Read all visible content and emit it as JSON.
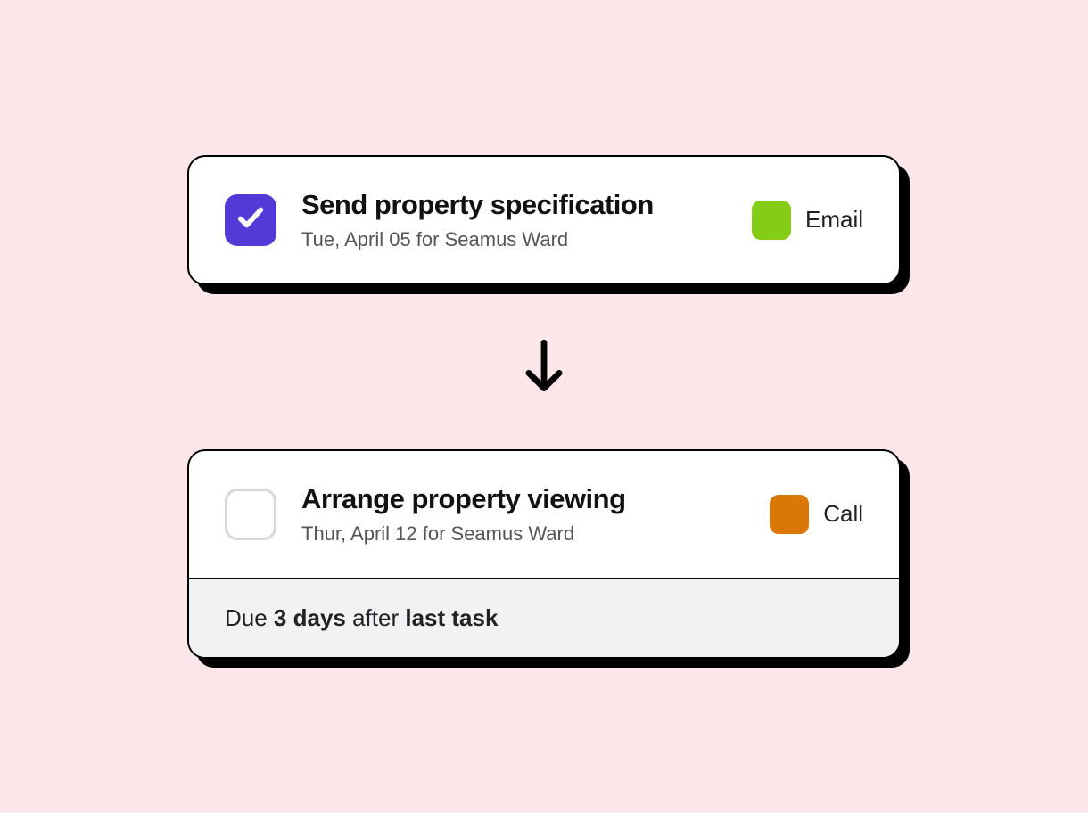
{
  "tasks": [
    {
      "checked": true,
      "title": "Send property specification",
      "subtitle": "Tue, April 05 for Seamus Ward",
      "tag": {
        "label": "Email",
        "color": "#85cc16"
      }
    },
    {
      "checked": false,
      "title": "Arrange property viewing",
      "subtitle": "Thur, April 12 for Seamus Ward",
      "tag": {
        "label": "Call",
        "color": "#d97707"
      }
    }
  ],
  "due_rule": {
    "prefix": "Due ",
    "strong1": "3 days",
    "mid": " after ",
    "strong2": "last task"
  }
}
